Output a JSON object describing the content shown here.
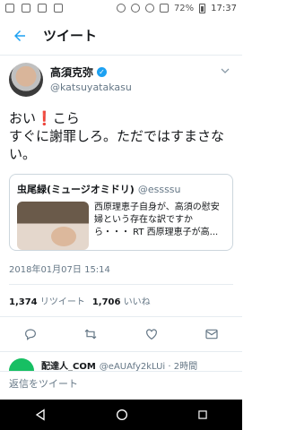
{
  "status_bar": {
    "battery": "72%",
    "time": "17:37"
  },
  "app_bar": {
    "title": "ツイート"
  },
  "tweet": {
    "display_name": "高須克弥",
    "handle": "@katsuyatakasu",
    "text_before": "おい",
    "excl": "❗",
    "text_after": "こら",
    "text_line2": "すぐに謝罪しろ。ただではすまさない。",
    "quote": {
      "name": "虫尾緑(ミュージオミドリ)",
      "handle": "@essssu",
      "text": "西原理恵子自身が、高須の慰安婦という存在な訳ですから・・・ RT 西原理恵子が高..."
    },
    "timestamp": "2018年01月07日 15:14",
    "retweets": "1,374",
    "retweets_label": "リツイート",
    "likes": "1,706",
    "likes_label": "いいね"
  },
  "next_reply": {
    "name": "配達人_COM",
    "handle": "@eAUAfy2kLUi · 2時間"
  },
  "compose": {
    "placeholder": "返信をツイート"
  },
  "colors": {
    "accent": "#1da1f2",
    "text": "#14171a",
    "muted": "#657786"
  }
}
